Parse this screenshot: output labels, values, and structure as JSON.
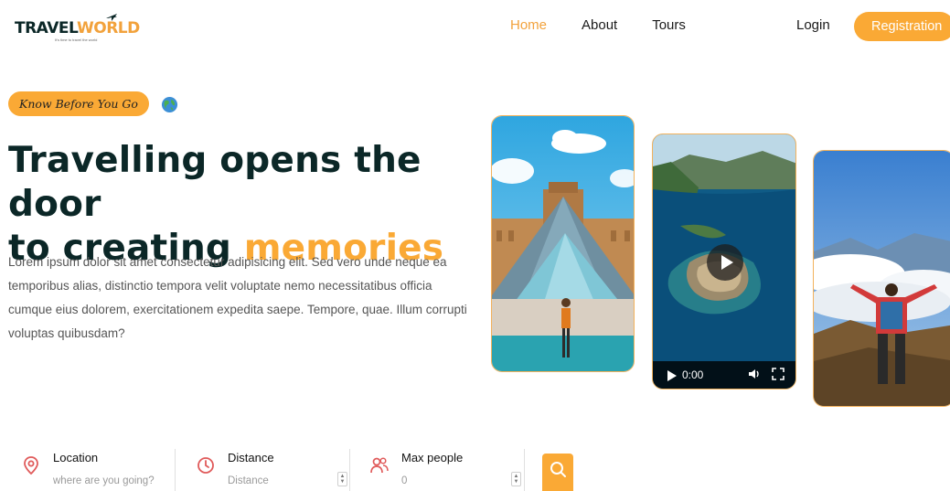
{
  "header": {
    "logo": {
      "text_part1": "TRAVEL",
      "text_part2": "WORLD",
      "tagline": "It's time to travel the world"
    },
    "nav": [
      {
        "label": "Home",
        "active": true
      },
      {
        "label": "About",
        "active": false
      },
      {
        "label": "Tours",
        "active": false
      }
    ],
    "login_label": "Login",
    "register_label": "Registration"
  },
  "hero": {
    "badge": "Know Before You Go",
    "title_line1": "Travelling opens the door",
    "title_line2_plain": "to creating ",
    "title_line2_highlight": "memories",
    "description": "Lorem ipsum dolor sit amet consectetur adipisicing elit. Sed vero unde neque ea temporibus alias, distinctio tempora velit voluptate nemo necessitatibus officia cumque eius dolorem, exercitationem expedita saepe. Tempore, quae. Illum corrupti voluptas quibusdam?"
  },
  "video": {
    "time": "0:00"
  },
  "search": {
    "location": {
      "label": "Location",
      "placeholder": "where are you going?"
    },
    "distance": {
      "label": "Distance",
      "placeholder": "Distance"
    },
    "people": {
      "label": "Max people",
      "placeholder": "0"
    }
  },
  "colors": {
    "accent": "#faa935",
    "heading": "#0b2727",
    "icon_red": "#e05a5a"
  },
  "icons": [
    "plane-icon",
    "globe-icon",
    "play-icon",
    "volume-icon",
    "fullscreen-icon",
    "location-pin-icon",
    "clock-icon",
    "people-icon",
    "search-icon"
  ]
}
